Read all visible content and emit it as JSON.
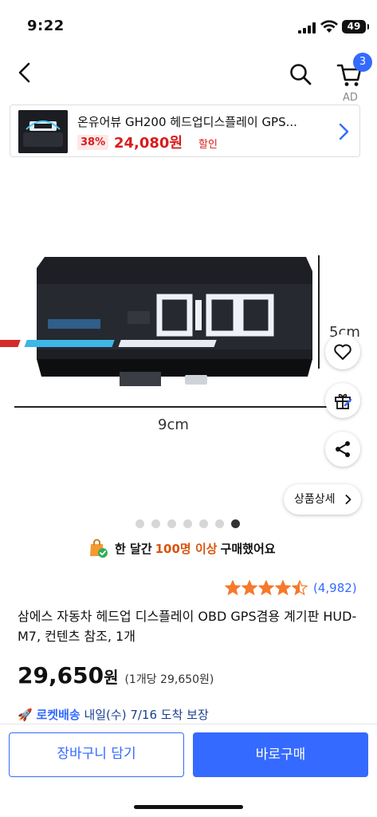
{
  "status": {
    "time": "9:22",
    "battery": "49"
  },
  "nav": {
    "cart_count": "3"
  },
  "ad": {
    "label": "AD",
    "title": "온유어뷰 GH200 헤드업디스플레이 GPS...",
    "discount": "38%",
    "price": "24,080원",
    "sale_label": "할인"
  },
  "image": {
    "width_label": "9cm",
    "height_label": "5cm"
  },
  "gallery": {
    "detail_label": "상품상세",
    "dot_count": 7,
    "active_index": 6
  },
  "purchase_note": {
    "prefix": "한 달간",
    "highlight": "100명 이상",
    "suffix": "구매했어요"
  },
  "rating": {
    "stars": 4.5,
    "count": "(4,982)"
  },
  "product": {
    "title": "삼에스 자동차 헤드업 디스플레이 OBD GPS겸용 계기판 HUD-M7, 컨텐츠 참조, 1개",
    "price": "29,650",
    "currency": "원",
    "unit_price": "(1개당 29,650원)"
  },
  "delivery": {
    "rocket": "로켓배송",
    "text": "내일(수) 7/16 도착 보장"
  },
  "actions": {
    "add_to_cart": "장바구니 담기",
    "buy_now": "바로구매"
  },
  "colors": {
    "accent": "#346aff",
    "sale": "#d91c1c",
    "star": "#f5792a"
  }
}
